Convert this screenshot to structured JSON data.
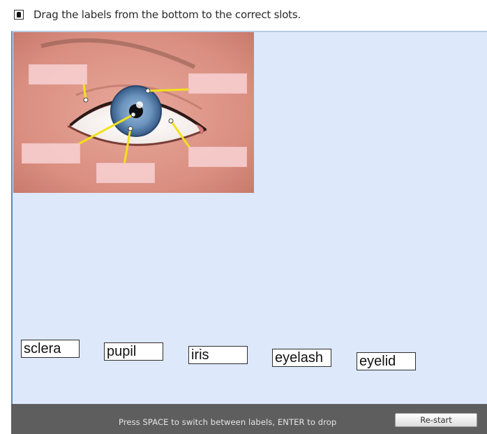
{
  "header": {
    "icon": "keyhole-info-icon",
    "instruction": "Drag the labels from the bottom to the correct slots."
  },
  "illustration": {
    "subject": "eye-diagram",
    "slots": [
      "slot-1",
      "slot-2",
      "slot-3",
      "slot-4",
      "slot-5"
    ],
    "pointer_color": "#f2e21a"
  },
  "labels": [
    {
      "text": "sclera"
    },
    {
      "text": "pupil"
    },
    {
      "text": "iris"
    },
    {
      "text": "eyelash"
    },
    {
      "text": "eyelid"
    }
  ],
  "footer": {
    "hint": "Press SPACE to switch between labels, ENTER to drop",
    "restart_label": "Re-start"
  },
  "colors": {
    "board_bg": "#dde8fb",
    "footer_bg": "#5e5e5e",
    "slot_fill": "#f5cdcd"
  }
}
